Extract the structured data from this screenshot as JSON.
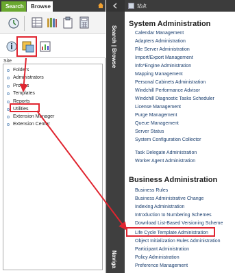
{
  "tabs": {
    "search": "Search",
    "browse": "Browse"
  },
  "strip": {
    "browse_label": "Search | Browse",
    "navigate_label": "Naviga"
  },
  "right_header": {
    "breadcrumb": "站点"
  },
  "site_label": "Site",
  "tree": {
    "items": [
      "Folders",
      "Administrators",
      "Profiles",
      "Templates",
      "Reports",
      "Utilities",
      "Extension Manager",
      "Extension Center"
    ]
  },
  "system_admin": {
    "title": "System Administration",
    "links": [
      "Calendar Management",
      "Adapters Administration",
      "File Server Administration",
      "Import/Export Management",
      "Info*Engine Administration",
      "Mapping Management",
      "Personal Cabinets Administration",
      "Windchill Performance Advisor",
      "Windchill Diagnostic Tasks Scheduler",
      "License Management",
      "Purge Management",
      "Queue Management",
      "Server Status",
      "System Configuration Collector",
      "Task Delegate Administration",
      "Worker Agent Administration"
    ]
  },
  "business_admin": {
    "title": "Business Administration",
    "links": [
      "Business Rules",
      "Business Administrative Change",
      "Indexing Administration",
      "Introduction to Numbering Schemes",
      "Download List-Based Versioning Scheme",
      "Life Cycle Template Administration",
      "Object Initialization Rules Administration",
      "Participant Administration",
      "Policy Administration",
      "Preference Management"
    ]
  },
  "colors": {
    "accent_tab": "#6aa82f",
    "highlight": "#e0242f",
    "link": "#1a3e6e"
  }
}
